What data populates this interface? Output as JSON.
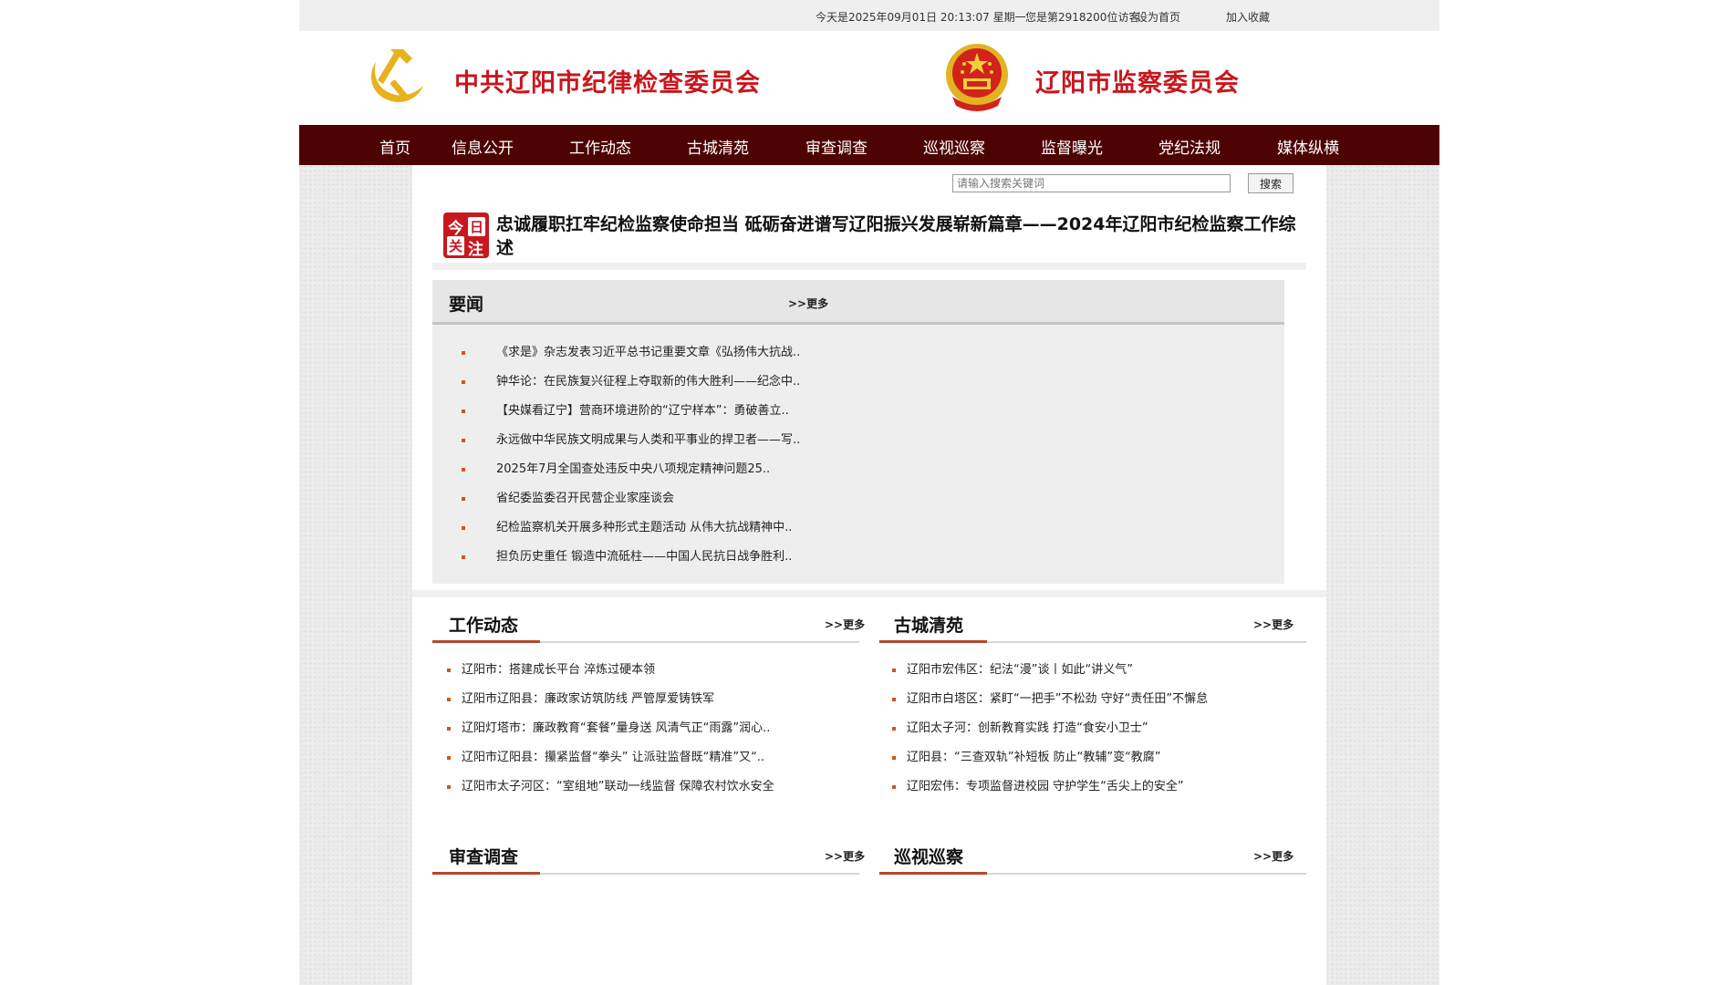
{
  "topbar": {
    "date_text": "今天是2025年09月01日 20:13:07 星期一",
    "visitor_text": "您是第2918200位访客",
    "set_home": "设为首页",
    "add_favorite": "加入收藏"
  },
  "header": {
    "left_title": "中共辽阳市纪律检查委员会",
    "right_title": "辽阳市监察委员会"
  },
  "nav": {
    "items": [
      "首页",
      "信息公开",
      "工作动态",
      "古城清苑",
      "审查调查",
      "巡视巡察",
      "监督曝光",
      "党纪法规",
      "媒体纵横"
    ]
  },
  "search": {
    "placeholder": "请输入搜索关键词",
    "button": "搜索"
  },
  "headline": {
    "badge_chars": [
      "今",
      "日",
      "关",
      "注"
    ],
    "text": "忠诚履职扛牢纪检监察使命担当 砥砺奋进谱写辽阳振兴发展崭新篇章——2024年辽阳市纪检监察工作综述"
  },
  "more_label": ">>更多",
  "yaowen": {
    "title": "要闻",
    "items": [
      "《求是》杂志发表习近平总书记重要文章《弘扬伟大抗战..",
      "钟华论：在民族复兴征程上夺取新的伟大胜利——纪念中..",
      "【央媒看辽宁】营商环境进阶的“辽宁样本”：勇破善立..",
      "永远做中华民族文明成果与人类和平事业的捍卫者——写..",
      "2025年7月全国查处违反中央八项规定精神问题25..",
      "省纪委监委召开民营企业家座谈会",
      "纪检监察机关开展多种形式主题活动 从伟大抗战精神中..",
      "担负历史重任 锻造中流砥柱——中国人民抗日战争胜利.."
    ]
  },
  "gongzuo": {
    "title": "工作动态",
    "items": [
      "辽阳市：搭建成长平台 淬炼过硬本领",
      "辽阳市辽阳县：廉政家访筑防线 严管厚爱铸铁军",
      "辽阳灯塔市：廉政教育“套餐”量身送 风清气正“雨露”润心..",
      "辽阳市辽阳县：攥紧监督“拳头” 让派驻监督既“精准”又“..",
      "辽阳市太子河区：“室组地”联动一线监督 保障农村饮水安全"
    ]
  },
  "gucheng": {
    "title": "古城清苑",
    "items": [
      "辽阳市宏伟区：纪法“漫”谈丨如此“讲义气”",
      "辽阳市白塔区：紧盯“一把手”不松劲 守好“责任田”不懈怠",
      "辽阳太子河：创新教育实践 打造“食安小卫士”",
      "辽阳县：“三查双轨”补短板 防止“教辅”变“教腐”",
      "辽阳宏伟：专项监督进校园 守护学生“舌尖上的安全”"
    ]
  },
  "shencha": {
    "title": "审查调查"
  },
  "xunshi": {
    "title": "巡视巡察"
  },
  "colors": {
    "nav_bg": "#4e0303",
    "brand_red": "#c8171e",
    "accent_orange": "#b2492a"
  }
}
